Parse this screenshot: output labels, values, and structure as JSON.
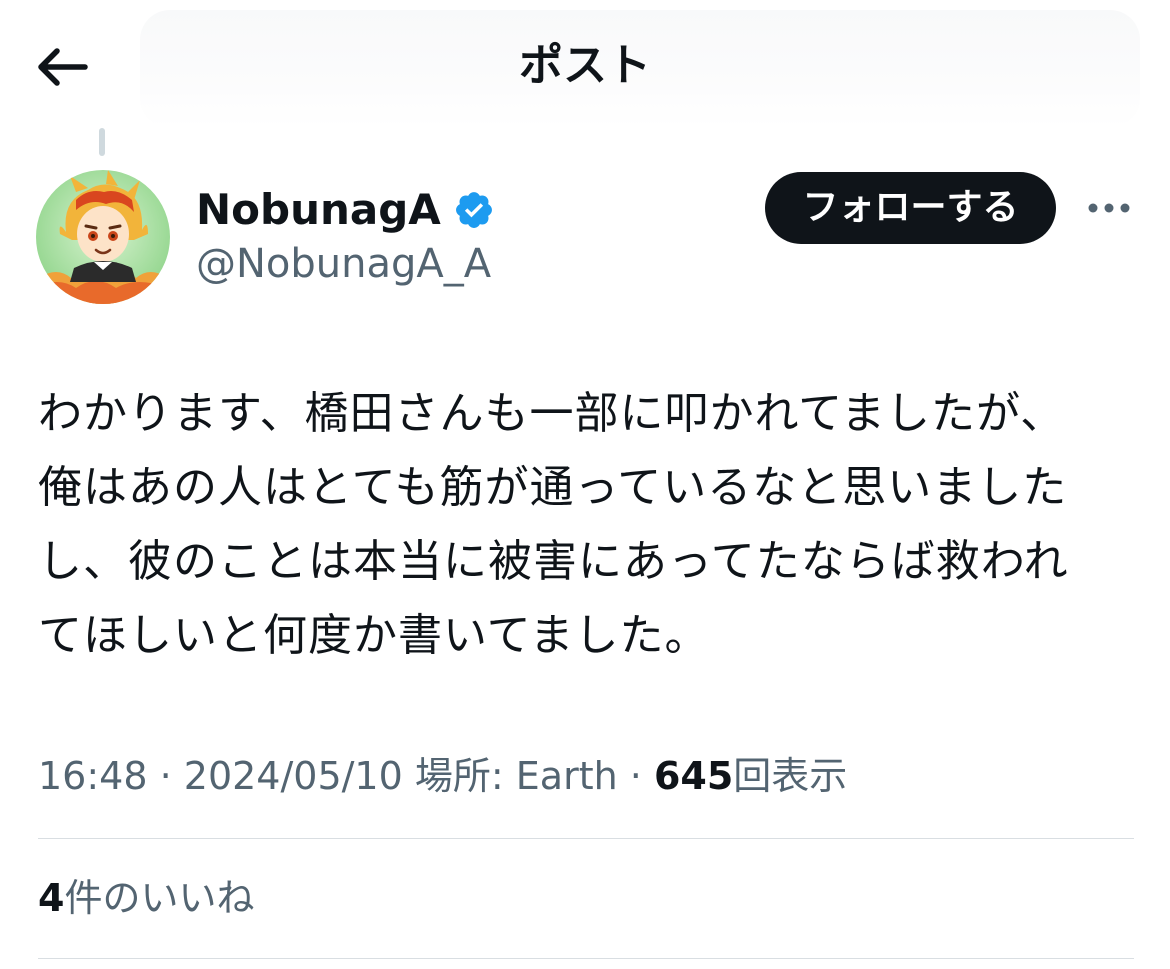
{
  "header": {
    "title": "ポスト",
    "back_icon": "arrow-left-icon"
  },
  "author": {
    "display_name": "NobunagA",
    "handle": "@NobunagA_A",
    "verified": true,
    "verified_color": "#1d9bf0"
  },
  "actions": {
    "follow_label": "フォローする",
    "more_icon": "more-horizontal-icon"
  },
  "tweet": {
    "text": "わかります、橋田さんも一部に叩かれてましたが、\n俺はあの人はとても筋が通っているなと思いました\nし、彼のことは本当に被害にあってたならば救われ\nてほしいと何度か書いてました。"
  },
  "meta": {
    "time": "16:48",
    "separator": " · ",
    "date": "2024/05/10",
    "location": "場所: Earth",
    "views_count": "645",
    "views_label": "回表示"
  },
  "stats": {
    "likes_count": "4",
    "likes_label": "件のいいね"
  },
  "colors": {
    "text_primary": "#0f1419",
    "text_secondary": "#536471",
    "divider": "#d9dee2",
    "follow_bg": "#0f1419"
  }
}
